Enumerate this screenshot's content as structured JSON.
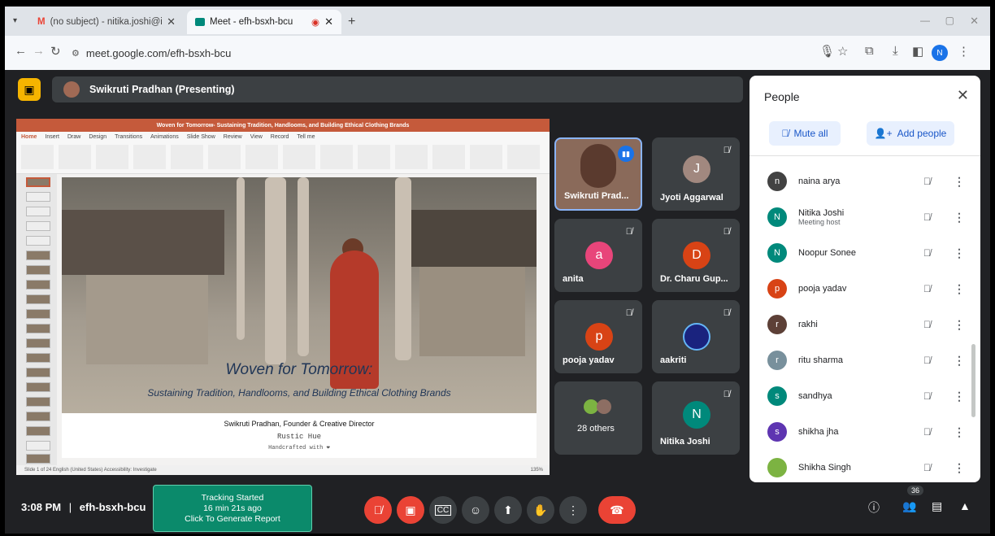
{
  "browser": {
    "tabs": [
      {
        "title": "(no subject) - nitika.joshi@ihe.c",
        "icon": "gmail-icon"
      },
      {
        "title": "Meet - efh-bsxh-bcu",
        "icon": "meet-icon"
      }
    ],
    "url": "meet.google.com/efh-bsxh-bcu",
    "profile_initial": "N"
  },
  "meeting": {
    "presenter_banner": "Swikruti Pradhan (Presenting)",
    "time": "3:08 PM",
    "code": "efh-bsxh-bcu",
    "tracking": {
      "line1": "Tracking Started",
      "line2": "16 min 21s ago",
      "line3": "Click To Generate Report"
    },
    "participant_count": "36"
  },
  "presentation": {
    "window_title": "Woven for Tomorrow- Sustaining Tradition, Handlooms, and Building Ethical Clothing Brands",
    "menu": [
      "Home",
      "Insert",
      "Draw",
      "Design",
      "Transitions",
      "Animations",
      "Slide Show",
      "Review",
      "View",
      "Record",
      "Tell me"
    ],
    "slide_title": "Woven for Tomorrow:",
    "slide_subtitle": "Sustaining Tradition, Handlooms, and Building Ethical Clothing Brands",
    "founder": "Swikruti Pradhan, Founder & Creative Director",
    "brand": "Rustic Hue",
    "tagline": "Handcrafted with ❤",
    "status": "Slide 1 of 24  English (United States)  Accessibility: Investigate",
    "zoom": "135%"
  },
  "tiles": [
    {
      "name": "Swikruti Prad...",
      "initial": "",
      "color": "#8a6a5a"
    },
    {
      "name": "Jyoti Aggarwal",
      "initial": "J",
      "color": "#a1887f"
    },
    {
      "name": "anita",
      "initial": "a",
      "color": "#e8457a"
    },
    {
      "name": "Dr. Charu Gup...",
      "initial": "D",
      "color": "#d84315"
    },
    {
      "name": "pooja yadav",
      "initial": "p",
      "color": "#d84315"
    },
    {
      "name": "aakriti",
      "initial": "",
      "color": "#1a237e"
    },
    {
      "name": "28 others",
      "initial": "",
      "color": "#3c4043"
    },
    {
      "name": "Nitika Joshi",
      "initial": "N",
      "color": "#00897b"
    }
  ],
  "people_panel": {
    "title": "People",
    "mute_all": "Mute all",
    "add_people": "Add people",
    "list": [
      {
        "name": "naina arya",
        "sub": "",
        "initial": "n",
        "color": "#424242"
      },
      {
        "name": "Nitika Joshi",
        "sub": "Meeting host",
        "initial": "N",
        "color": "#00897b"
      },
      {
        "name": "Noopur Sonee",
        "sub": "",
        "initial": "N",
        "color": "#00897b"
      },
      {
        "name": "pooja yadav",
        "sub": "",
        "initial": "p",
        "color": "#d84315"
      },
      {
        "name": "rakhi",
        "sub": "",
        "initial": "r",
        "color": "#5d4037"
      },
      {
        "name": "ritu sharma",
        "sub": "",
        "initial": "r",
        "color": "#78909c"
      },
      {
        "name": "sandhya",
        "sub": "",
        "initial": "s",
        "color": "#00897b"
      },
      {
        "name": "shikha jha",
        "sub": "",
        "initial": "s",
        "color": "#5e35b1"
      },
      {
        "name": "Shikha Singh",
        "sub": "",
        "initial": "",
        "color": "#7cb342"
      }
    ]
  }
}
